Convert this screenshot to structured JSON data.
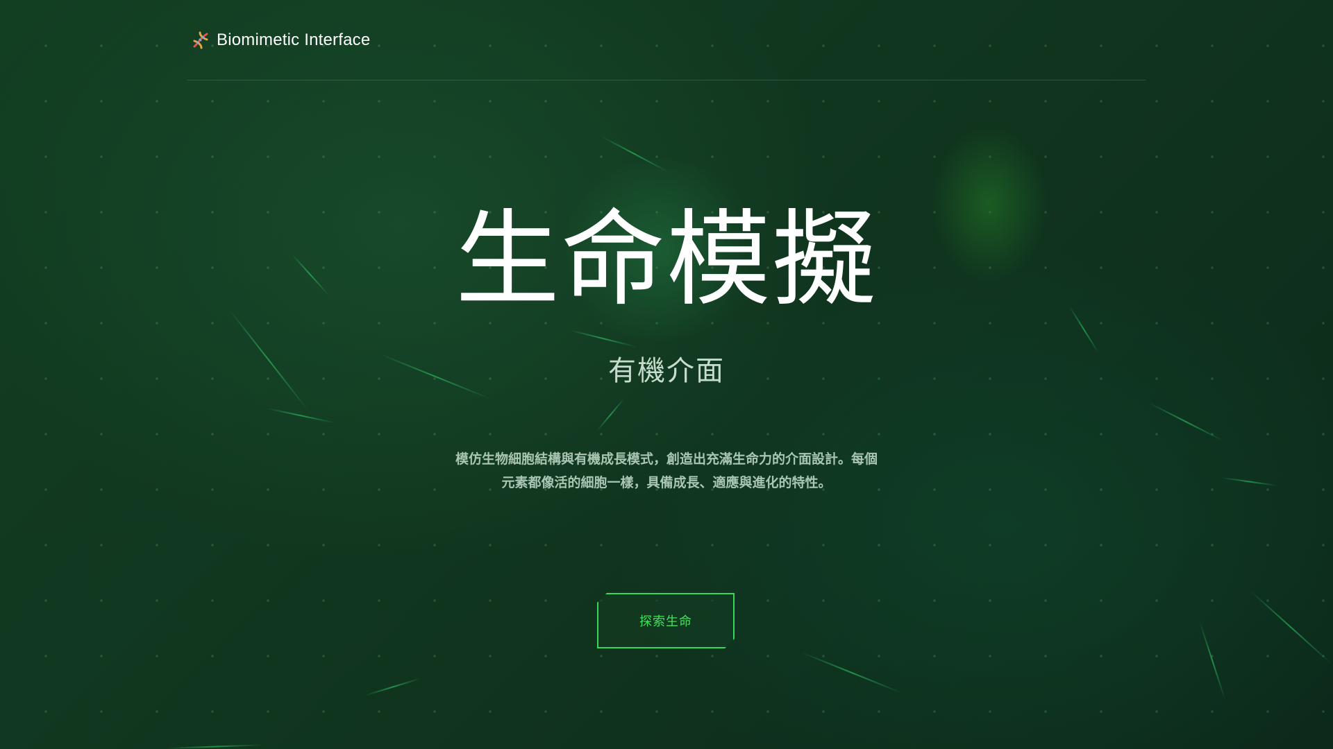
{
  "header": {
    "brand": "Biomimetic Interface",
    "logo_icon": "dna-icon"
  },
  "hero": {
    "title": "生命模擬",
    "subtitle": "有機介面",
    "description": "模仿生物細胞結構與有機成長模式，創造出充滿生命力的介面設計。每個元素都像活的細胞一樣，具備成長、適應與進化的特性。",
    "cta_label": "探索生命"
  },
  "colors": {
    "background": "#123e22",
    "accent": "#38d958",
    "text": "#ffffff"
  }
}
